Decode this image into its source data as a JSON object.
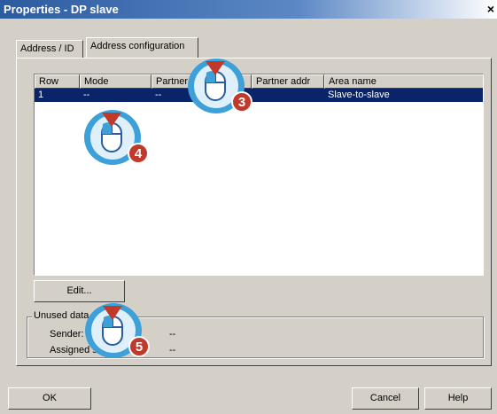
{
  "window": {
    "title": "Properties - DP slave",
    "close_glyph": "×"
  },
  "tabs": [
    {
      "label": "Address / ID"
    },
    {
      "label": "Address configuration"
    }
  ],
  "table": {
    "columns": [
      "Row",
      "Mode",
      "Partner DP addr",
      "Partner addr",
      "Area name"
    ],
    "rows": [
      {
        "row": "1",
        "mode": "--",
        "partner_dp_addr": "--",
        "partner_addr": "",
        "area_name": "Slave-to-slave"
      }
    ]
  },
  "edit_button": "Edit...",
  "unused": {
    "legend": "Unused data",
    "sender_label": "Sender:",
    "sender_value": "--",
    "assigned_label": "Assigned s",
    "assigned_value": "--"
  },
  "buttons": {
    "ok": "OK",
    "cancel": "Cancel",
    "help": "Help"
  },
  "callouts": [
    {
      "number": "3",
      "icon": "mouse-click-icon"
    },
    {
      "number": "4",
      "icon": "mouse-click-icon"
    },
    {
      "number": "5",
      "icon": "mouse-click-icon"
    }
  ],
  "colors": {
    "selection": "#0a246a",
    "callout_blue": "#3ea0d8",
    "callout_red": "#c0392b"
  }
}
